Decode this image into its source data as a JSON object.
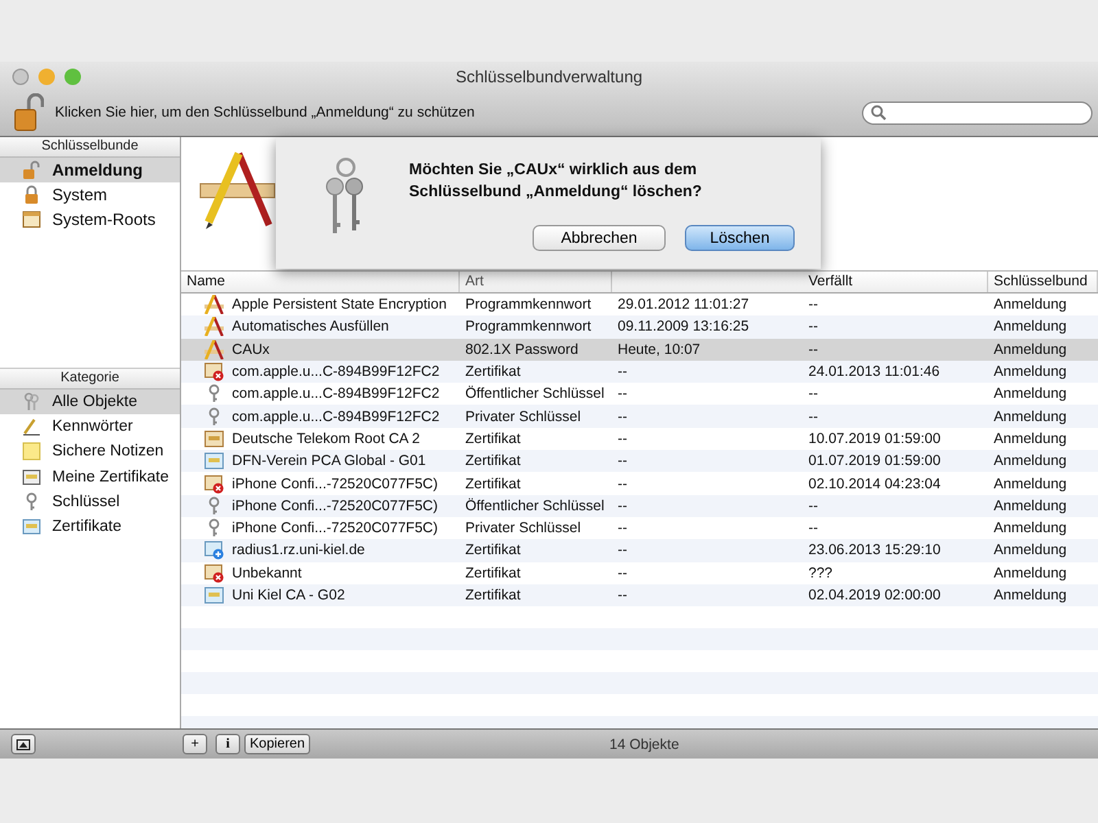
{
  "window": {
    "title": "Schlüsselbundverwaltung"
  },
  "toolbar": {
    "lock_hint": "Klicken Sie hier, um den Schlüsselbund „Anmeldung“ zu schützen"
  },
  "sidebar": {
    "keychains_title": "Schlüsselbunde",
    "keychains": [
      {
        "label": "Anmeldung",
        "kind": "unlocked",
        "selected": true
      },
      {
        "label": "System",
        "kind": "locked",
        "selected": false
      },
      {
        "label": "System-Roots",
        "kind": "cabinet",
        "selected": false
      }
    ],
    "categories_title": "Kategorie",
    "categories": [
      {
        "label": "Alle Objekte",
        "kind": "all",
        "selected": true
      },
      {
        "label": "Kennwörter",
        "kind": "passwords",
        "selected": false
      },
      {
        "label": "Sichere Notizen",
        "kind": "notes",
        "selected": false
      },
      {
        "label": "Meine Zertifikate",
        "kind": "mycert",
        "selected": false
      },
      {
        "label": "Schlüssel",
        "kind": "key",
        "selected": false
      },
      {
        "label": "Zertifikate",
        "kind": "cert",
        "selected": false
      }
    ]
  },
  "dialog": {
    "message": "Möchten Sie „CAUx“ wirklich aus dem Schlüsselbund „Anmeldung“ löschen?",
    "buttons": [
      {
        "label": "Abbrechen",
        "default": false
      },
      {
        "label": "Löschen",
        "default": true
      }
    ]
  },
  "table": {
    "columns": [
      "Name",
      "Art",
      "Verfällt",
      "Schlüsselbund"
    ],
    "rows": [
      {
        "kind": "app",
        "name": "Apple Persistent State Encryption",
        "type": "Programmkennwort",
        "date": "29.01.2012 11:01:27",
        "expires": "--",
        "keychain": "Anmeldung",
        "selected": false
      },
      {
        "kind": "app",
        "name": "Automatisches Ausfüllen",
        "type": "Programmkennwort",
        "date": "09.11.2009 13:16:25",
        "expires": "--",
        "keychain": "Anmeldung",
        "selected": false
      },
      {
        "kind": "app",
        "name": "CAUx",
        "type": "802.1X Password",
        "date": "Heute, 10:07",
        "expires": "--",
        "keychain": "Anmeldung",
        "selected": true
      },
      {
        "kind": "cert-error",
        "name": "com.apple.u...C-894B99F12FC2",
        "type": "Zertifikat",
        "date": "--",
        "expires": "24.01.2013 11:01:46",
        "keychain": "Anmeldung",
        "selected": false
      },
      {
        "kind": "key",
        "name": "com.apple.u...C-894B99F12FC2",
        "type": "Öffentlicher Schlüssel",
        "date": "--",
        "expires": "--",
        "keychain": "Anmeldung",
        "selected": false
      },
      {
        "kind": "key",
        "name": "com.apple.u...C-894B99F12FC2",
        "type": "Privater Schlüssel",
        "date": "--",
        "expires": "--",
        "keychain": "Anmeldung",
        "selected": false
      },
      {
        "kind": "cert-root",
        "name": "Deutsche Telekom Root CA 2",
        "type": "Zertifikat",
        "date": "--",
        "expires": "10.07.2019 01:59:00",
        "keychain": "Anmeldung",
        "selected": false
      },
      {
        "kind": "cert",
        "name": "DFN-Verein PCA Global - G01",
        "type": "Zertifikat",
        "date": "--",
        "expires": "01.07.2019 01:59:00",
        "keychain": "Anmeldung",
        "selected": false
      },
      {
        "kind": "cert-error",
        "name": "iPhone Confi...-72520C077F5C)",
        "type": "Zertifikat",
        "date": "--",
        "expires": "02.10.2014 04:23:04",
        "keychain": "Anmeldung",
        "selected": false
      },
      {
        "kind": "key",
        "name": "iPhone Confi...-72520C077F5C)",
        "type": "Öffentlicher Schlüssel",
        "date": "--",
        "expires": "--",
        "keychain": "Anmeldung",
        "selected": false
      },
      {
        "kind": "key",
        "name": "iPhone Confi...-72520C077F5C)",
        "type": "Privater Schlüssel",
        "date": "--",
        "expires": "--",
        "keychain": "Anmeldung",
        "selected": false
      },
      {
        "kind": "cert-plus",
        "name": "radius1.rz.uni-kiel.de",
        "type": "Zertifikat",
        "date": "--",
        "expires": "23.06.2013 15:29:10",
        "keychain": "Anmeldung",
        "selected": false
      },
      {
        "kind": "cert-error",
        "name": "Unbekannt",
        "type": "Zertifikat",
        "date": "--",
        "expires": "???",
        "keychain": "Anmeldung",
        "selected": false
      },
      {
        "kind": "cert",
        "name": "Uni Kiel CA - G02",
        "type": "Zertifikat",
        "date": "--",
        "expires": "02.04.2019 02:00:00",
        "keychain": "Anmeldung",
        "selected": false
      }
    ]
  },
  "bottom_bar": {
    "copy_button": "Kopieren",
    "info_button": "i",
    "add_button": "+",
    "status": "14 Objekte"
  }
}
